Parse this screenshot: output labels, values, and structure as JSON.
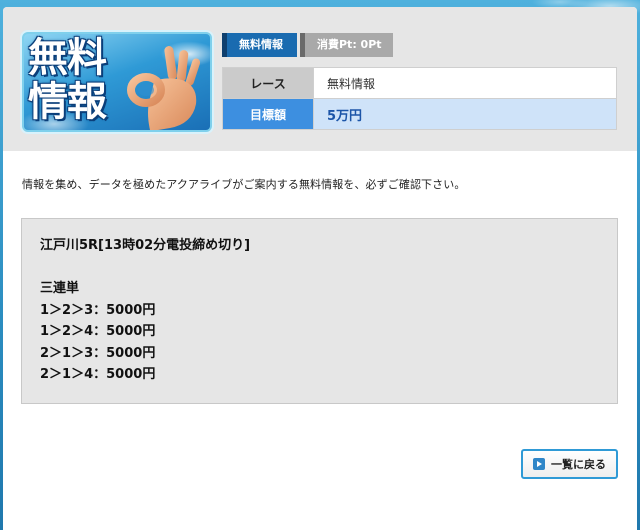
{
  "banner": {
    "text": "無料\n情報",
    "icon": "ok-hand-gesture"
  },
  "tags": {
    "free_label": "無料情報",
    "points_label": "消費Pt: 0Pt"
  },
  "info_table": {
    "rows": [
      {
        "label": "レース",
        "value": "無料情報"
      },
      {
        "label": "目標額",
        "value": "5万円"
      }
    ]
  },
  "intro_text": "情報を集め、データを極めたアクアライブがご案内する無料情報を、必ずご確認下さい。",
  "content": {
    "race_title": "江戸川5R[13時02分電投締め切り]",
    "bet_type": "三連単",
    "bets": [
      "1＞2＞3：5000円",
      "1＞2＞4：5000円",
      "2＞1＞3：5000円",
      "2＞1＞4：5000円"
    ]
  },
  "back_button": {
    "label": "一覧に戻る",
    "icon": "arrow-right-icon"
  },
  "colors": {
    "accent_blue": "#1a6bb0",
    "target_row_bg": "#3d8fe0",
    "target_value_bg": "#cfe3f9",
    "button_border": "#2f9ad6"
  }
}
